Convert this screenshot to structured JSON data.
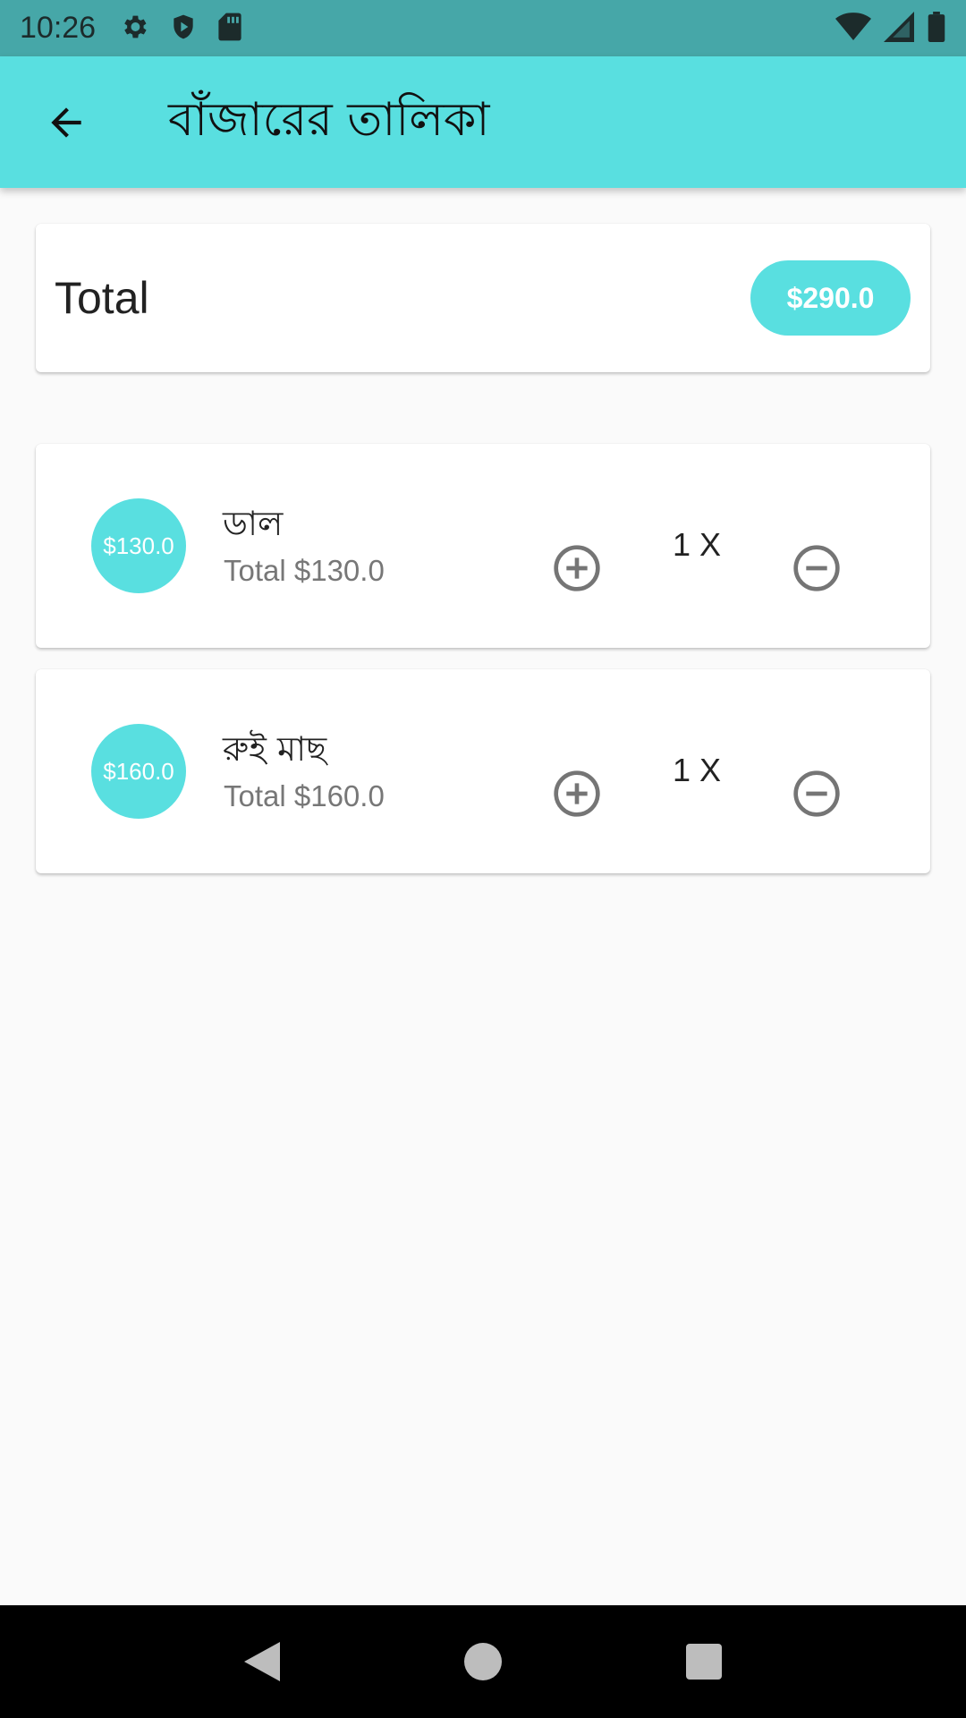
{
  "status_bar": {
    "time": "10:26"
  },
  "app_bar": {
    "title": "বাঁজারের তালিকা"
  },
  "total": {
    "label": "Total",
    "amount": "$290.0"
  },
  "items": [
    {
      "price_badge": "$130.0",
      "name": "ডাল",
      "total_text": "Total $130.0",
      "quantity": "1 X"
    },
    {
      "price_badge": "$160.0",
      "name": "রুই মাছ",
      "total_text": "Total $160.0",
      "quantity": "1 X"
    }
  ],
  "colors": {
    "accent": "#59dfe0",
    "status_bar": "#46a7a8",
    "icon_grey": "#757575"
  }
}
